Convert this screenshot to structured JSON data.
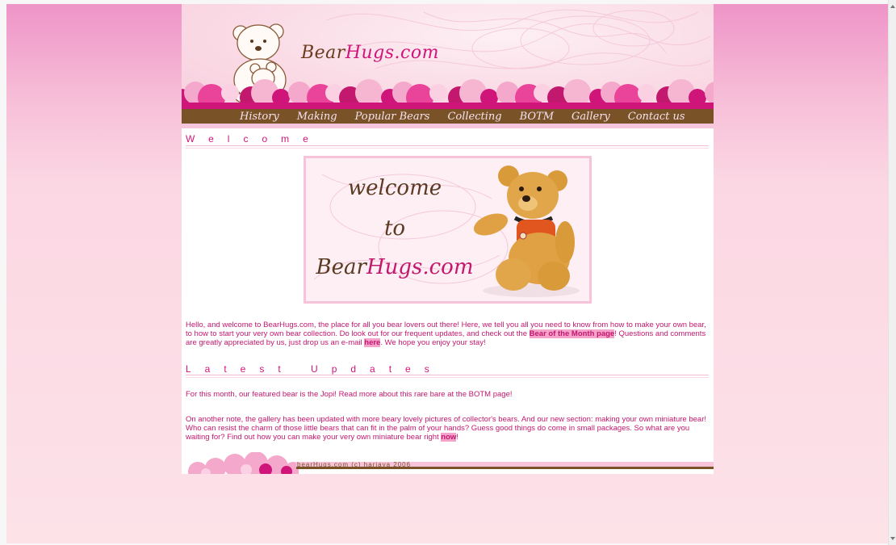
{
  "site": {
    "title_part1": "Bear",
    "title_part2": "Hugs.com"
  },
  "nav": {
    "items": [
      "History",
      "Making",
      "Popular Bears",
      "Collecting",
      "BOTM",
      "Gallery",
      "Contact us"
    ]
  },
  "welcome": {
    "heading": "Welcome",
    "banner": {
      "line1": "welcome",
      "line2": "to",
      "brand_part1": "Bear",
      "brand_part2": "Hugs.com"
    },
    "intro": {
      "text1": "Hello, and welcome to BearHugs.com, the place for all you bear lovers out there! Here, we tell you all you need to know from how to make your own bear, to how to start your very own bear collection. Do look out for our frequent updates, and check out the ",
      "link1": "Bear of the Month page",
      "text2": "! Questions and comments are greatly appreciated by us, just drop us an e-mail ",
      "link2": "here",
      "text3": ". We hope you enjoy your stay!"
    }
  },
  "updates": {
    "heading": "Latest Updates",
    "para1": "For this month, our featured bear is the Jopi! Read more about this rare bare at the BOTM page!",
    "para2": {
      "text1": "On another note, the gallery has been updated with more beary lovely pictures of collector's bears. And our new section: making your own miniature bear! Who can resist the charm of those little bears that can fit in the palm of your hands? Guess good things do come in small packages. So what are you waiting for? Find out how you can make your very own miniature bear right ",
      "link": "now",
      "text2": "!"
    }
  },
  "footer": {
    "text": "bearHugs.com (c) hariaya 2006"
  },
  "colors": {
    "accent": "#d0157a",
    "nav_bg": "#7a5228",
    "highlight": "#f6a3cb"
  }
}
